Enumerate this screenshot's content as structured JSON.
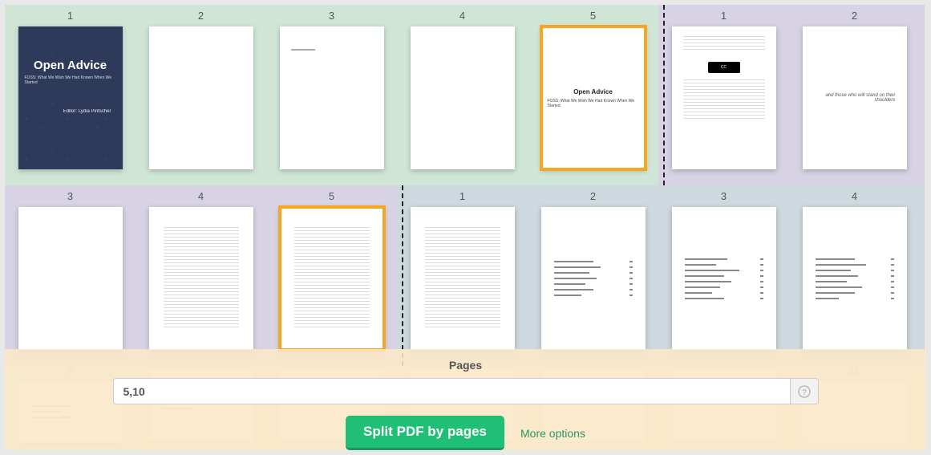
{
  "cover": {
    "title": "Open Advice",
    "subtitle": "FOSS: What We Wish We Had Known When We Started",
    "editor": "Editor: Lydia Pintscher"
  },
  "titlepage": {
    "title": "Open Advice",
    "subtitle": "FOSS: What We Wish We Had Known When We Started"
  },
  "quote": "and those who will stand on their shoulders",
  "row1_green_nums": [
    "1",
    "2",
    "3",
    "4",
    "5"
  ],
  "row1_purple_nums": [
    "1",
    "2"
  ],
  "row2_purple_nums": [
    "3",
    "4",
    "5"
  ],
  "row2_blue_nums": [
    "1",
    "2",
    "3",
    "4"
  ],
  "row3_nums": [
    "5",
    "",
    "",
    "",
    "",
    "",
    "11"
  ],
  "panel": {
    "label": "Pages",
    "input_value": "5,10",
    "help": "?",
    "split_btn": "Split PDF by pages",
    "more": "More options"
  }
}
